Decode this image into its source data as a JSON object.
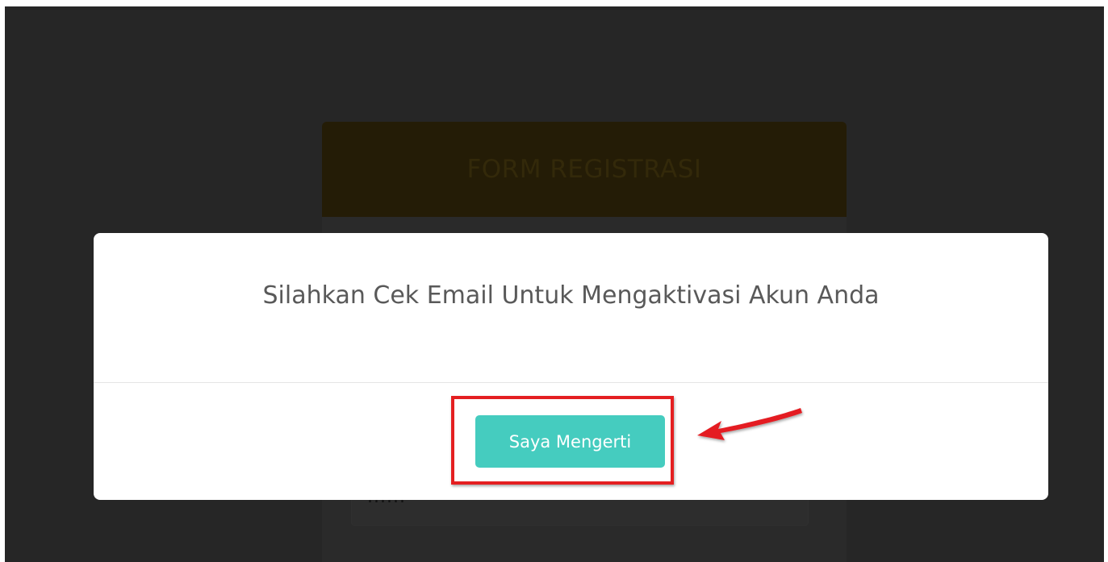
{
  "background_form": {
    "title": "FORM REGISTRASI",
    "input_value": "......",
    "header_color": "#241c06"
  },
  "modal": {
    "message": "Silahkan Cek Email Untuk Mengaktivasi Akun Anda",
    "confirm_button_label": "Saya Mengerti",
    "button_color": "#45ccbf"
  },
  "annotation": {
    "highlight_color": "#e41f21",
    "icons": [
      "highlight-box",
      "red-arrow-icon"
    ]
  }
}
